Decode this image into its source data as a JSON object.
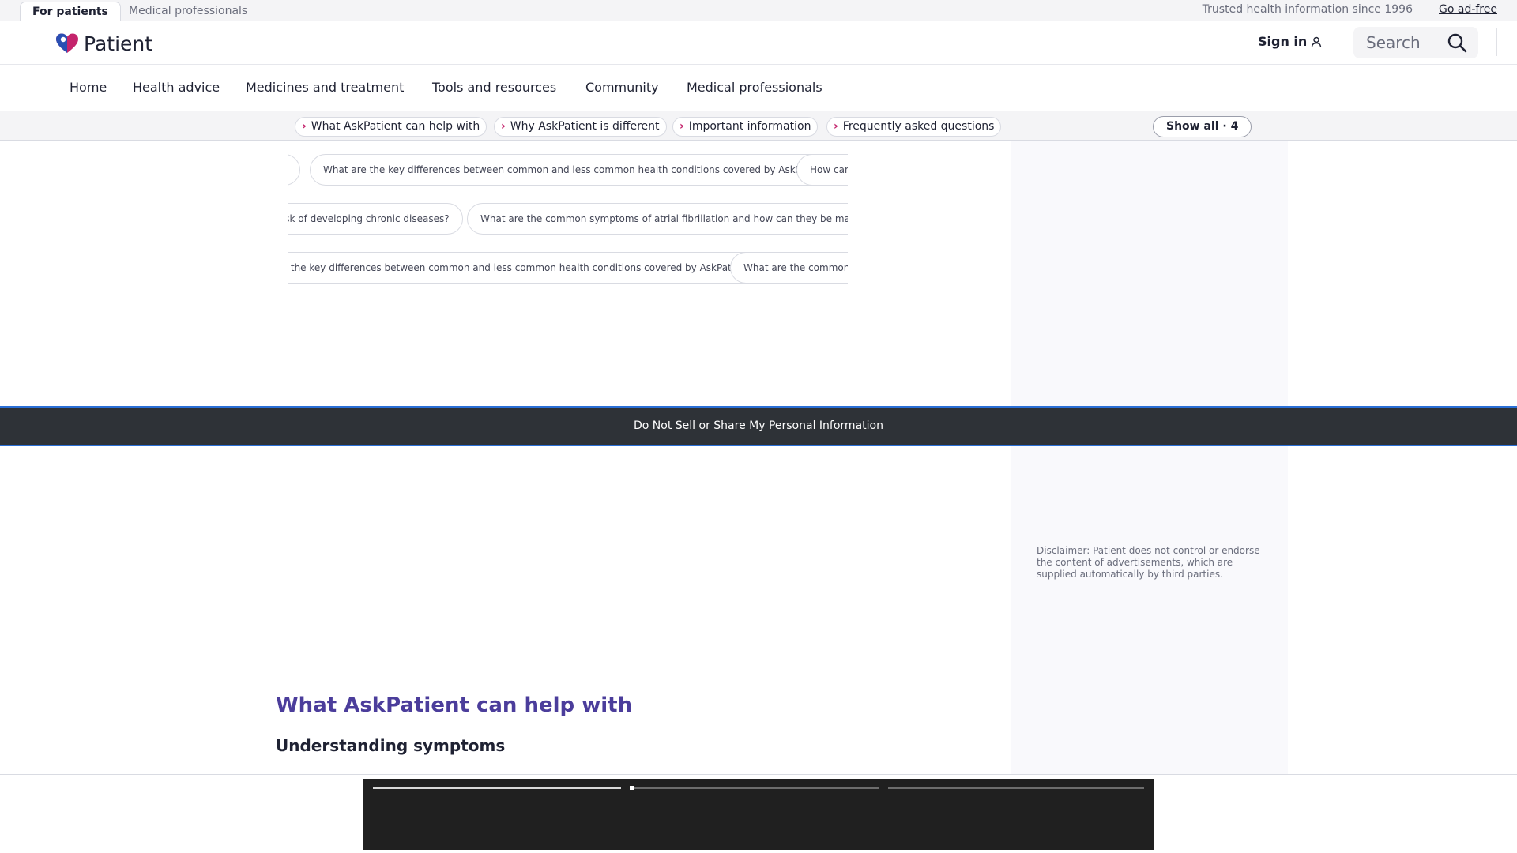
{
  "audience_bar": {
    "tabs": [
      "For patients",
      "Medical professionals"
    ],
    "trusted_text": "Trusted health information since 1996",
    "ad_free_link": "Go ad-free"
  },
  "header": {
    "logo_text": "Patient",
    "sign_in": "Sign in",
    "search_placeholder": "Search",
    "colors": {
      "brand_pink": "#c4246c",
      "brand_blue": "#2a4fb3"
    }
  },
  "nav": {
    "items": [
      "Home",
      "Health advice",
      "Medicines and treatment",
      "Tools and resources",
      "Community",
      "Medical professionals"
    ]
  },
  "anchors": {
    "chips": [
      "What AskPatient can help with",
      "Why AskPatient is different",
      "Important information",
      "Frequently asked questions"
    ],
    "show_all": "Show all · 4"
  },
  "questions": {
    "row1": [
      "What are the key differences between common and less common health conditions covered by AskPatient?",
      "How can"
    ],
    "row2": [
      "risk of developing chronic diseases?",
      "What are the common symptoms of atrial fibrillation and how can they be managed?"
    ],
    "row3": [
      "re the key differences between common and less common health conditions covered by AskPatient?",
      "What are the common sy"
    ]
  },
  "privacy_banner": "Do Not Sell or Share My Personal Information",
  "ad": {
    "disclaimer": "Disclaimer: Patient does not control or endorse the content of advertisements, which are supplied automatically by third parties."
  },
  "content": {
    "section_title": "What AskPatient can help with",
    "subtitle": "Understanding symptoms"
  },
  "player": {
    "segments_progress": [
      1.0,
      0.0,
      0.0
    ]
  }
}
